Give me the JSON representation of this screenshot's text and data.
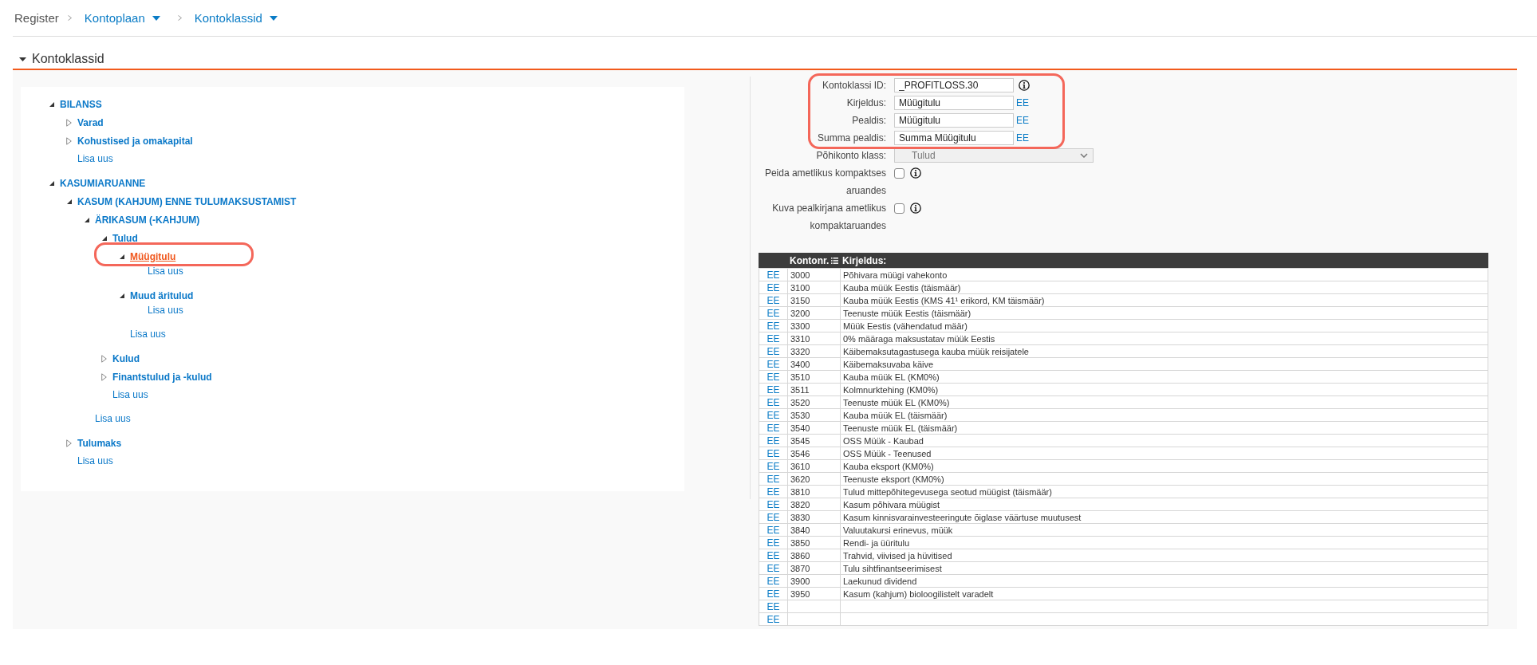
{
  "breadcrumb": [
    {
      "kind": "text",
      "label": "Register"
    },
    {
      "kind": "dropdown",
      "label": "Kontoplaan"
    },
    {
      "kind": "dropdown",
      "label": "Kontoklassid"
    }
  ],
  "section": {
    "title": "Kontoklassid",
    "expanded": true
  },
  "tree": [
    {
      "label": "BILANSS",
      "expanded": true,
      "selected": false,
      "highlighted": false,
      "children": [
        {
          "label": "Varad",
          "expanded": false,
          "selected": false,
          "highlighted": false
        },
        {
          "label": "Kohustised ja omakapital",
          "expanded": false,
          "selected": false,
          "highlighted": false
        }
      ],
      "add_link": "Lisa uus"
    },
    {
      "label": "KASUMIARUANNE",
      "expanded": true,
      "selected": false,
      "highlighted": false,
      "children": [
        {
          "label": "KASUM (KAHJUM) ENNE TULUMAKSUSTAMIST",
          "expanded": true,
          "selected": false,
          "highlighted": false,
          "children": [
            {
              "label": "ÄRIKASUM (-KAHJUM)",
              "expanded": true,
              "selected": false,
              "highlighted": false,
              "children": [
                {
                  "label": "Tulud",
                  "expanded": true,
                  "selected": false,
                  "highlighted": false,
                  "children": [
                    {
                      "label": "Müügitulu",
                      "expanded": true,
                      "selected": true,
                      "highlighted": true,
                      "add_link": "Lisa uus"
                    },
                    {
                      "label": "Muud äritulud",
                      "expanded": true,
                      "selected": false,
                      "highlighted": false,
                      "add_link": "Lisa uus"
                    }
                  ],
                  "add_link": "Lisa uus"
                },
                {
                  "label": "Kulud",
                  "expanded": false,
                  "selected": false,
                  "highlighted": false
                },
                {
                  "label": "Finantstulud ja -kulud",
                  "expanded": false,
                  "selected": false,
                  "highlighted": false
                }
              ],
              "add_link": "Lisa uus"
            }
          ],
          "add_link": "Lisa uus"
        },
        {
          "label": "Tulumaks",
          "expanded": false,
          "selected": false,
          "highlighted": false
        }
      ],
      "add_link": "Lisa uus"
    }
  ],
  "form": {
    "fields": [
      {
        "kind": "text",
        "label": "Kontoklassi ID:",
        "value": "_PROFITLOSS.30",
        "info": true,
        "disabled": false,
        "highlighted": true
      },
      {
        "kind": "text",
        "label": "Kirjeldus:",
        "value": "Müügitulu",
        "lang_link": "EE",
        "info": false,
        "disabled": false,
        "highlighted": true
      },
      {
        "kind": "text",
        "label": "Pealdis:",
        "value": "Müügitulu",
        "lang_link": "EE",
        "info": false,
        "disabled": false,
        "highlighted": true
      },
      {
        "kind": "text",
        "label": "Summa pealdis:",
        "value": "Summa Müügitulu",
        "lang_link": "EE",
        "info": false,
        "disabled": false,
        "highlighted": true
      },
      {
        "kind": "select",
        "label": "Põhikonto klass:",
        "value": "Tulud",
        "info": false,
        "disabled": true,
        "highlighted": false
      },
      {
        "kind": "checkbox",
        "label": "Peida ametlikus kompaktses aruandes",
        "checked": false,
        "info": true,
        "disabled": false,
        "highlighted": false
      },
      {
        "kind": "checkbox",
        "label": "Kuva pealkirjana ametlikus kompaktaruandes",
        "checked": false,
        "info": true,
        "disabled": false,
        "highlighted": false
      }
    ]
  },
  "table": {
    "columns": [
      {
        "label": "Kontonr.",
        "kind": "menu"
      },
      {
        "label": "Kirjeldus:",
        "kind": "plain"
      }
    ],
    "rows": [
      {
        "lang": "EE",
        "number": "3000",
        "description": "Põhivara müügi vahekonto"
      },
      {
        "lang": "EE",
        "number": "3100",
        "description": "Kauba müük Eestis (täismäär)"
      },
      {
        "lang": "EE",
        "number": "3150",
        "description": "Kauba müük Eestis (KMS 41¹ erikord, KM täismäär)"
      },
      {
        "lang": "EE",
        "number": "3200",
        "description": "Teenuste müük Eestis (täismäär)"
      },
      {
        "lang": "EE",
        "number": "3300",
        "description": "Müük Eestis (vähendatud määr)"
      },
      {
        "lang": "EE",
        "number": "3310",
        "description": "0% määraga maksustatav müük Eestis"
      },
      {
        "lang": "EE",
        "number": "3320",
        "description": "Käibemaksutagastusega kauba müük reisijatele"
      },
      {
        "lang": "EE",
        "number": "3400",
        "description": "Käibemaksuvaba käive"
      },
      {
        "lang": "EE",
        "number": "3510",
        "description": "Kauba müük EL (KM0%)"
      },
      {
        "lang": "EE",
        "number": "3511",
        "description": "Kolmnurktehing (KM0%)"
      },
      {
        "lang": "EE",
        "number": "3520",
        "description": "Teenuste müük EL (KM0%)"
      },
      {
        "lang": "EE",
        "number": "3530",
        "description": "Kauba müük EL (täismäär)"
      },
      {
        "lang": "EE",
        "number": "3540",
        "description": "Teenuste müük EL (täismäär)"
      },
      {
        "lang": "EE",
        "number": "3545",
        "description": "OSS Müük - Kaubad"
      },
      {
        "lang": "EE",
        "number": "3546",
        "description": "OSS Müük - Teenused"
      },
      {
        "lang": "EE",
        "number": "3610",
        "description": "Kauba eksport (KM0%)"
      },
      {
        "lang": "EE",
        "number": "3620",
        "description": "Teenuste eksport (KM0%)"
      },
      {
        "lang": "EE",
        "number": "3810",
        "description": "Tulud mittepõhitegevusega seotud müügist (täismäär)"
      },
      {
        "lang": "EE",
        "number": "3820",
        "description": "Kasum põhivara müügist"
      },
      {
        "lang": "EE",
        "number": "3830",
        "description": "Kasum kinnisvarainvesteeringute õiglase väärtuse muutusest"
      },
      {
        "lang": "EE",
        "number": "3840",
        "description": "Valuutakursi erinevus, müük"
      },
      {
        "lang": "EE",
        "number": "3850",
        "description": "Rendi- ja üüritulu"
      },
      {
        "lang": "EE",
        "number": "3860",
        "description": "Trahvid, viivised ja hüvitised"
      },
      {
        "lang": "EE",
        "number": "3870",
        "description": "Tulu sihtfinantseerimisest"
      },
      {
        "lang": "EE",
        "number": "3900",
        "description": "Laekunud dividend"
      },
      {
        "lang": "EE",
        "number": "3950",
        "description": "Kasum (kahjum) bioloogilistelt varadelt"
      },
      {
        "lang": "EE"
      },
      {
        "lang": "EE"
      }
    ]
  }
}
